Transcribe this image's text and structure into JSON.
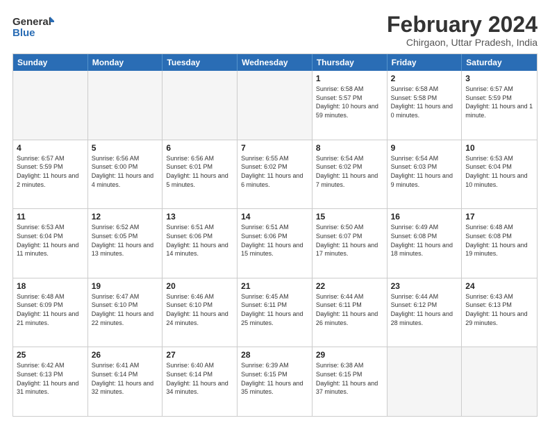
{
  "logo": {
    "line1": "General",
    "line2": "Blue"
  },
  "title": "February 2024",
  "subtitle": "Chirgaon, Uttar Pradesh, India",
  "headers": [
    "Sunday",
    "Monday",
    "Tuesday",
    "Wednesday",
    "Thursday",
    "Friday",
    "Saturday"
  ],
  "rows": [
    [
      {
        "day": "",
        "info": "",
        "empty": true
      },
      {
        "day": "",
        "info": "",
        "empty": true
      },
      {
        "day": "",
        "info": "",
        "empty": true
      },
      {
        "day": "",
        "info": "",
        "empty": true
      },
      {
        "day": "1",
        "info": "Sunrise: 6:58 AM\nSunset: 5:57 PM\nDaylight: 10 hours and 59 minutes."
      },
      {
        "day": "2",
        "info": "Sunrise: 6:58 AM\nSunset: 5:58 PM\nDaylight: 11 hours and 0 minutes."
      },
      {
        "day": "3",
        "info": "Sunrise: 6:57 AM\nSunset: 5:59 PM\nDaylight: 11 hours and 1 minute."
      }
    ],
    [
      {
        "day": "4",
        "info": "Sunrise: 6:57 AM\nSunset: 5:59 PM\nDaylight: 11 hours and 2 minutes."
      },
      {
        "day": "5",
        "info": "Sunrise: 6:56 AM\nSunset: 6:00 PM\nDaylight: 11 hours and 4 minutes."
      },
      {
        "day": "6",
        "info": "Sunrise: 6:56 AM\nSunset: 6:01 PM\nDaylight: 11 hours and 5 minutes."
      },
      {
        "day": "7",
        "info": "Sunrise: 6:55 AM\nSunset: 6:02 PM\nDaylight: 11 hours and 6 minutes."
      },
      {
        "day": "8",
        "info": "Sunrise: 6:54 AM\nSunset: 6:02 PM\nDaylight: 11 hours and 7 minutes."
      },
      {
        "day": "9",
        "info": "Sunrise: 6:54 AM\nSunset: 6:03 PM\nDaylight: 11 hours and 9 minutes."
      },
      {
        "day": "10",
        "info": "Sunrise: 6:53 AM\nSunset: 6:04 PM\nDaylight: 11 hours and 10 minutes."
      }
    ],
    [
      {
        "day": "11",
        "info": "Sunrise: 6:53 AM\nSunset: 6:04 PM\nDaylight: 11 hours and 11 minutes."
      },
      {
        "day": "12",
        "info": "Sunrise: 6:52 AM\nSunset: 6:05 PM\nDaylight: 11 hours and 13 minutes."
      },
      {
        "day": "13",
        "info": "Sunrise: 6:51 AM\nSunset: 6:06 PM\nDaylight: 11 hours and 14 minutes."
      },
      {
        "day": "14",
        "info": "Sunrise: 6:51 AM\nSunset: 6:06 PM\nDaylight: 11 hours and 15 minutes."
      },
      {
        "day": "15",
        "info": "Sunrise: 6:50 AM\nSunset: 6:07 PM\nDaylight: 11 hours and 17 minutes."
      },
      {
        "day": "16",
        "info": "Sunrise: 6:49 AM\nSunset: 6:08 PM\nDaylight: 11 hours and 18 minutes."
      },
      {
        "day": "17",
        "info": "Sunrise: 6:48 AM\nSunset: 6:08 PM\nDaylight: 11 hours and 19 minutes."
      }
    ],
    [
      {
        "day": "18",
        "info": "Sunrise: 6:48 AM\nSunset: 6:09 PM\nDaylight: 11 hours and 21 minutes."
      },
      {
        "day": "19",
        "info": "Sunrise: 6:47 AM\nSunset: 6:10 PM\nDaylight: 11 hours and 22 minutes."
      },
      {
        "day": "20",
        "info": "Sunrise: 6:46 AM\nSunset: 6:10 PM\nDaylight: 11 hours and 24 minutes."
      },
      {
        "day": "21",
        "info": "Sunrise: 6:45 AM\nSunset: 6:11 PM\nDaylight: 11 hours and 25 minutes."
      },
      {
        "day": "22",
        "info": "Sunrise: 6:44 AM\nSunset: 6:11 PM\nDaylight: 11 hours and 26 minutes."
      },
      {
        "day": "23",
        "info": "Sunrise: 6:44 AM\nSunset: 6:12 PM\nDaylight: 11 hours and 28 minutes."
      },
      {
        "day": "24",
        "info": "Sunrise: 6:43 AM\nSunset: 6:13 PM\nDaylight: 11 hours and 29 minutes."
      }
    ],
    [
      {
        "day": "25",
        "info": "Sunrise: 6:42 AM\nSunset: 6:13 PM\nDaylight: 11 hours and 31 minutes."
      },
      {
        "day": "26",
        "info": "Sunrise: 6:41 AM\nSunset: 6:14 PM\nDaylight: 11 hours and 32 minutes."
      },
      {
        "day": "27",
        "info": "Sunrise: 6:40 AM\nSunset: 6:14 PM\nDaylight: 11 hours and 34 minutes."
      },
      {
        "day": "28",
        "info": "Sunrise: 6:39 AM\nSunset: 6:15 PM\nDaylight: 11 hours and 35 minutes."
      },
      {
        "day": "29",
        "info": "Sunrise: 6:38 AM\nSunset: 6:15 PM\nDaylight: 11 hours and 37 minutes."
      },
      {
        "day": "",
        "info": "",
        "empty": true
      },
      {
        "day": "",
        "info": "",
        "empty": true
      }
    ]
  ]
}
